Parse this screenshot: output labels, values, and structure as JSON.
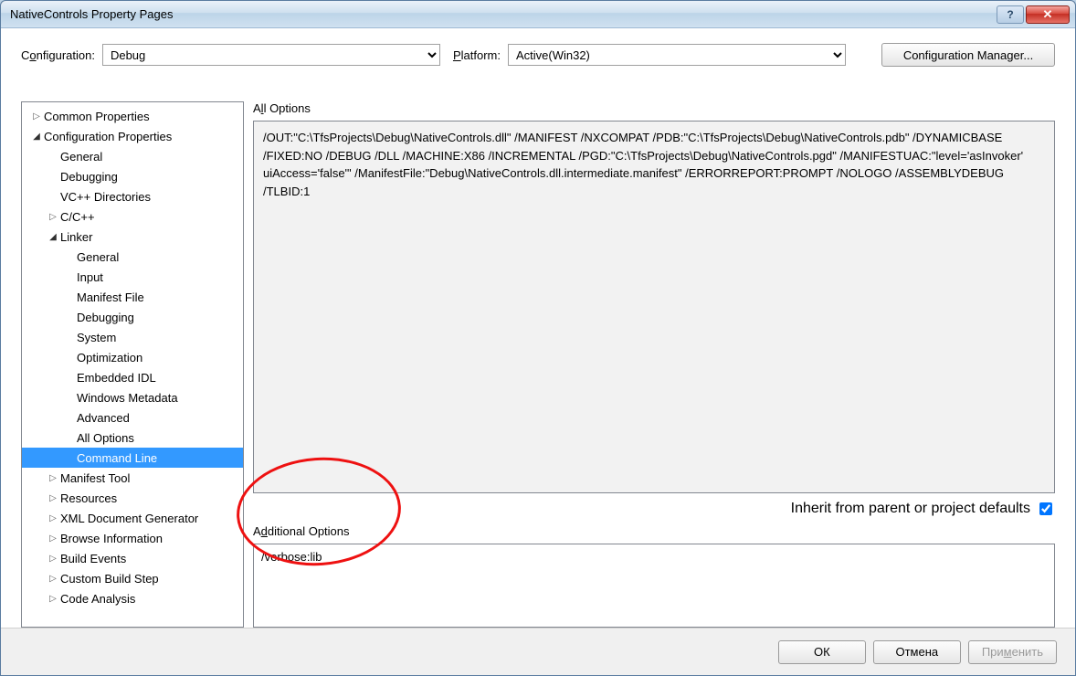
{
  "window": {
    "title": "NativeControls Property Pages"
  },
  "toolbar": {
    "configuration_label_pre": "C",
    "configuration_label_ul": "o",
    "configuration_label_post": "nfiguration:",
    "configuration_value": "Debug",
    "platform_label_pre": "",
    "platform_label_ul": "P",
    "platform_label_post": "latform:",
    "platform_value": "Active(Win32)",
    "config_manager": "Configuration Manager..."
  },
  "tree": {
    "common_properties": "Common Properties",
    "configuration_properties": "Configuration Properties",
    "general": "General",
    "debugging": "Debugging",
    "vc_dirs": "VC++ Directories",
    "ccpp": "C/C++",
    "linker": "Linker",
    "linker_general": "General",
    "linker_input": "Input",
    "linker_manifest_file": "Manifest File",
    "linker_debugging": "Debugging",
    "linker_system": "System",
    "linker_optimization": "Optimization",
    "linker_embedded_idl": "Embedded IDL",
    "linker_winmd": "Windows Metadata",
    "linker_advanced": "Advanced",
    "linker_all_options": "All Options",
    "linker_command_line": "Command Line",
    "manifest_tool": "Manifest Tool",
    "resources": "Resources",
    "xml_doc_gen": "XML Document Generator",
    "browse_info": "Browse Information",
    "build_events": "Build Events",
    "custom_build_step": "Custom Build Step",
    "code_analysis": "Code Analysis"
  },
  "right": {
    "all_options_label_pre": "A",
    "all_options_label_ul": "l",
    "all_options_label_post": "l Options",
    "all_options_text": "/OUT:\"C:\\TfsProjects\\Debug\\NativeControls.dll\" /MANIFEST /NXCOMPAT /PDB:\"C:\\TfsProjects\\Debug\\NativeControls.pdb\" /DYNAMICBASE /FIXED:NO /DEBUG /DLL /MACHINE:X86 /INCREMENTAL /PGD:\"C:\\TfsProjects\\Debug\\NativeControls.pgd\" /MANIFESTUAC:\"level='asInvoker' uiAccess='false'\" /ManifestFile:\"Debug\\NativeControls.dll.intermediate.manifest\" /ERRORREPORT:PROMPT /NOLOGO /ASSEMBLYDEBUG /TLBID:1",
    "inherit_label": "Inherit from parent or project defaults",
    "additional_options_label_pre": "A",
    "additional_options_label_ul": "d",
    "additional_options_label_post": "ditional Options",
    "additional_options_value": "/verbose:lib"
  },
  "buttons": {
    "ok": "ОК",
    "cancel": "Отмена",
    "apply_pre": "При",
    "apply_ul": "м",
    "apply_post": "енить"
  }
}
